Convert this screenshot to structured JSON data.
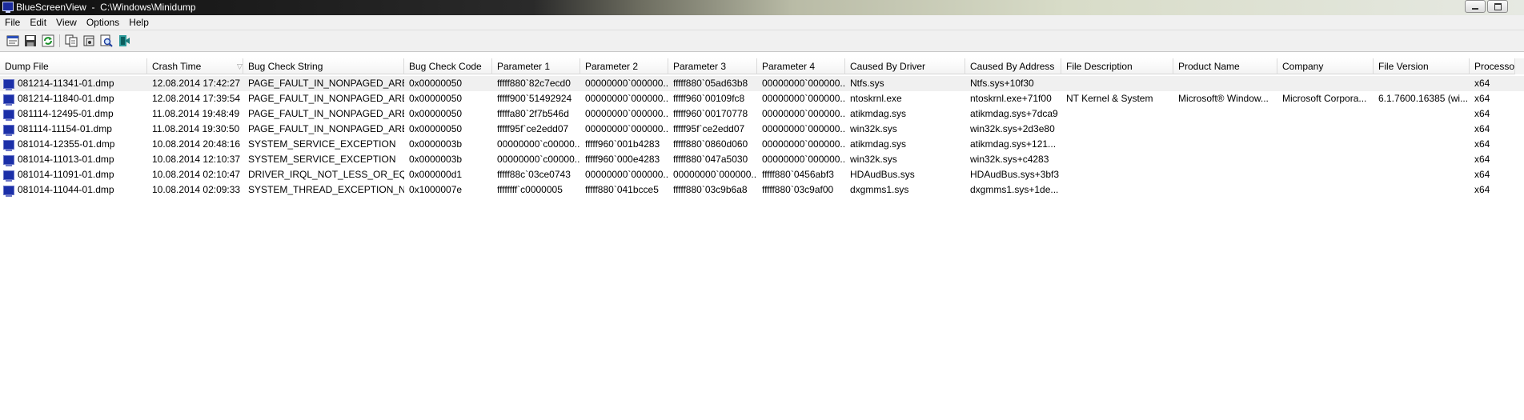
{
  "window": {
    "title": "BlueScreenView  -  C:\\Windows\\Minidump"
  },
  "menu": [
    "File",
    "Edit",
    "View",
    "Options",
    "Help"
  ],
  "toolbar": {
    "icons": [
      "properties-icon",
      "save-icon",
      "refresh-icon",
      "copy-icon",
      "html-report-icon",
      "find-icon",
      "exit-icon"
    ]
  },
  "columns": [
    "Dump File",
    "Crash Time",
    "Bug Check String",
    "Bug Check Code",
    "Parameter 1",
    "Parameter 2",
    "Parameter 3",
    "Parameter 4",
    "Caused By Driver",
    "Caused By Address",
    "File Description",
    "Product Name",
    "Company",
    "File Version",
    "Processor"
  ],
  "sort": {
    "column": "Crash Time",
    "direction": "descending"
  },
  "rows": [
    [
      "081214-11341-01.dmp",
      "12.08.2014 17:42:27",
      "PAGE_FAULT_IN_NONPAGED_AREA",
      "0x00000050",
      "fffff880`82c7ecd0",
      "00000000`000000...",
      "fffff880`05ad63b8",
      "00000000`000000...",
      "Ntfs.sys",
      "Ntfs.sys+10f30",
      "",
      "",
      "",
      "",
      "x64"
    ],
    [
      "081214-11840-01.dmp",
      "12.08.2014 17:39:54",
      "PAGE_FAULT_IN_NONPAGED_AREA",
      "0x00000050",
      "fffff900`51492924",
      "00000000`000000...",
      "fffff960`00109fc8",
      "00000000`000000...",
      "ntoskrnl.exe",
      "ntoskrnl.exe+71f00",
      "NT Kernel & System",
      "Microsoft® Window...",
      "Microsoft Corpora...",
      "6.1.7600.16385 (wi...",
      "x64"
    ],
    [
      "081114-12495-01.dmp",
      "11.08.2014 19:48:49",
      "PAGE_FAULT_IN_NONPAGED_AREA",
      "0x00000050",
      "fffffa80`2f7b546d",
      "00000000`000000...",
      "fffff960`00170778",
      "00000000`000000...",
      "atikmdag.sys",
      "atikmdag.sys+7dca9",
      "",
      "",
      "",
      "",
      "x64"
    ],
    [
      "081114-11154-01.dmp",
      "11.08.2014 19:30:50",
      "PAGE_FAULT_IN_NONPAGED_AREA",
      "0x00000050",
      "fffff95f`ce2edd07",
      "00000000`000000...",
      "fffff95f`ce2edd07",
      "00000000`000000...",
      "win32k.sys",
      "win32k.sys+2d3e80",
      "",
      "",
      "",
      "",
      "x64"
    ],
    [
      "081014-12355-01.dmp",
      "10.08.2014 20:48:16",
      "SYSTEM_SERVICE_EXCEPTION",
      "0x0000003b",
      "00000000`c00000...",
      "fffff960`001b4283",
      "fffff880`0860d060",
      "00000000`000000...",
      "atikmdag.sys",
      "atikmdag.sys+121...",
      "",
      "",
      "",
      "",
      "x64"
    ],
    [
      "081014-11013-01.dmp",
      "10.08.2014 12:10:37",
      "SYSTEM_SERVICE_EXCEPTION",
      "0x0000003b",
      "00000000`c00000...",
      "fffff960`000e4283",
      "fffff880`047a5030",
      "00000000`000000...",
      "win32k.sys",
      "win32k.sys+c4283",
      "",
      "",
      "",
      "",
      "x64"
    ],
    [
      "081014-11091-01.dmp",
      "10.08.2014 02:10:47",
      "DRIVER_IRQL_NOT_LESS_OR_EQU...",
      "0x000000d1",
      "fffff88c`03ce0743",
      "00000000`000000...",
      "00000000`000000...",
      "fffff880`0456abf3",
      "HDAudBus.sys",
      "HDAudBus.sys+3bf3",
      "",
      "",
      "",
      "",
      "x64"
    ],
    [
      "081014-11044-01.dmp",
      "10.08.2014 02:09:33",
      "SYSTEM_THREAD_EXCEPTION_N...",
      "0x1000007e",
      "ffffffff`c0000005",
      "fffff880`041bcce5",
      "fffff880`03c9b6a8",
      "fffff880`03c9af00",
      "dxgmms1.sys",
      "dxgmms1.sys+1de...",
      "",
      "",
      "",
      "",
      "x64"
    ]
  ]
}
